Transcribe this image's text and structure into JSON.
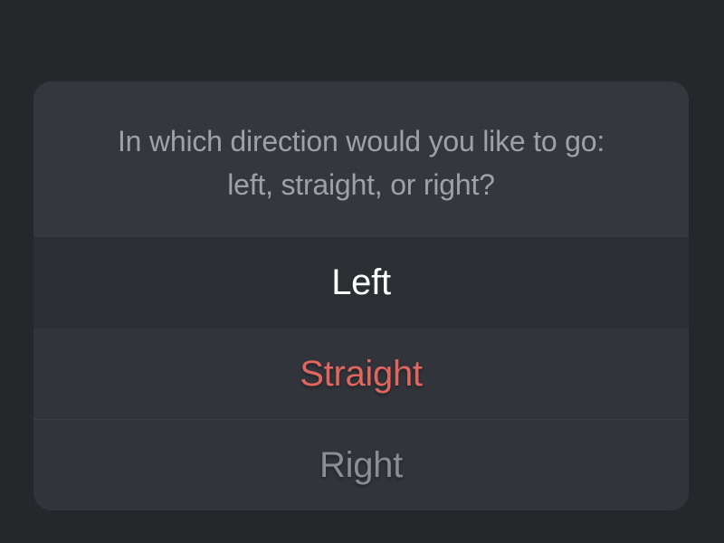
{
  "dialog": {
    "message_line_1": "In which direction would you like to go:",
    "message_line_2": "left, straight, or right?",
    "options": [
      {
        "label": "Left",
        "color": "#ffffff"
      },
      {
        "label": "Straight",
        "color": "#e0665f"
      },
      {
        "label": "Right",
        "color": "#8a8d91"
      }
    ]
  },
  "colors": {
    "background": "#25272b",
    "sheet": "#303338",
    "message_text": "#9ea1a5"
  }
}
